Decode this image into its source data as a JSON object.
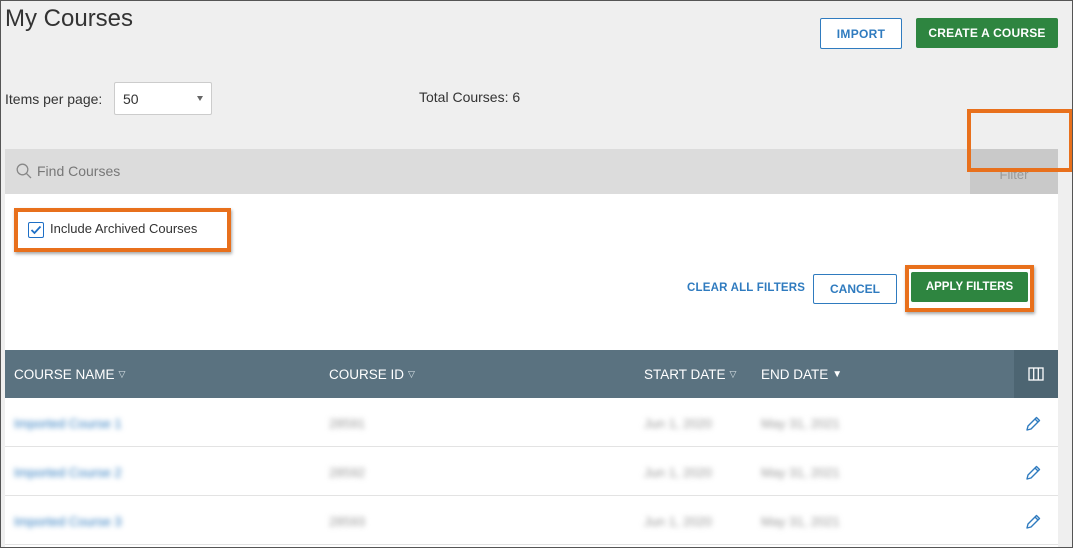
{
  "header": {
    "title": "My Courses",
    "import_label": "IMPORT",
    "create_label": "CREATE A COURSE"
  },
  "pagination": {
    "items_per_page_label": "Items per page:",
    "items_per_page_value": "50",
    "total_courses": "Total Courses: 6"
  },
  "search": {
    "placeholder": "Find Courses",
    "filter_label": "Filter"
  },
  "filters": {
    "include_archived_label": "Include Archived Courses",
    "include_archived_checked": true,
    "clear_all_label": "CLEAR ALL FILTERS",
    "cancel_label": "CANCEL",
    "apply_label": "APPLY FILTERS"
  },
  "table": {
    "columns": [
      {
        "label": "COURSE NAME",
        "sort": "none"
      },
      {
        "label": "COURSE ID",
        "sort": "none"
      },
      {
        "label": "START DATE",
        "sort": "none"
      },
      {
        "label": "END DATE",
        "sort": "desc"
      }
    ],
    "rows": [
      {
        "name": "Imported Course 1",
        "id": "28591",
        "start": "Jun 1, 2020",
        "end": "May 31, 2021"
      },
      {
        "name": "Imported Course 2",
        "id": "28592",
        "start": "Jun 1, 2020",
        "end": "May 31, 2021"
      },
      {
        "name": "Imported Course 3",
        "id": "28593",
        "start": "Jun 1, 2020",
        "end": "May 31, 2021"
      }
    ]
  },
  "colors": {
    "primary_green": "#2e8540",
    "link_blue": "#2f7bbf",
    "header_slate": "#5a7280",
    "highlight_orange": "#e8701c"
  },
  "icons": [
    "search-icon",
    "chevron-down-icon",
    "check-icon",
    "sort-icon",
    "columns-icon",
    "pencil-icon"
  ]
}
